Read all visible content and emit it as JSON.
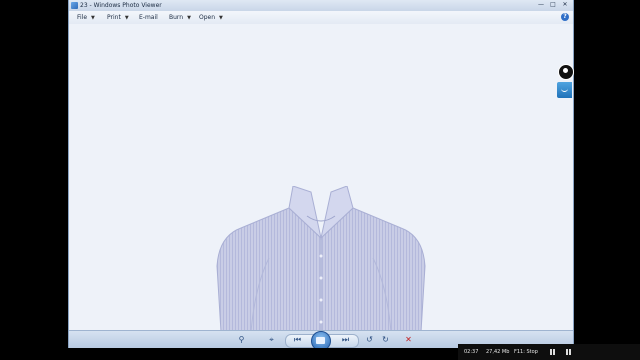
{
  "window": {
    "title": "23 - Windows Photo Viewer",
    "controls": {
      "minimize": "—",
      "maximize": "□",
      "close": "✕"
    }
  },
  "menu": {
    "items": [
      {
        "label": "File",
        "has_dropdown": true
      },
      {
        "label": "Print",
        "has_dropdown": true
      },
      {
        "label": "E-mail",
        "has_dropdown": false
      },
      {
        "label": "Burn",
        "has_dropdown": true
      },
      {
        "label": "Open",
        "has_dropdown": true
      }
    ],
    "caret": "▼",
    "help": "?"
  },
  "photo": {
    "subject": "shirt-image",
    "shirt_color": "#c9cde6",
    "shirt_stripe": "#aeb4d8"
  },
  "toolbar": {
    "zoom": "⚲",
    "fit": "⌖",
    "previous": "⏮",
    "next": "⏭",
    "rotate_ccw": "↺",
    "rotate_cw": "↻",
    "delete": "✕"
  },
  "status": {
    "time": "02:37",
    "size": "27,42 Mb",
    "hint": "F11: Stop"
  },
  "colors": {
    "accent": "#1f5fb0",
    "delete": "#c42020"
  }
}
